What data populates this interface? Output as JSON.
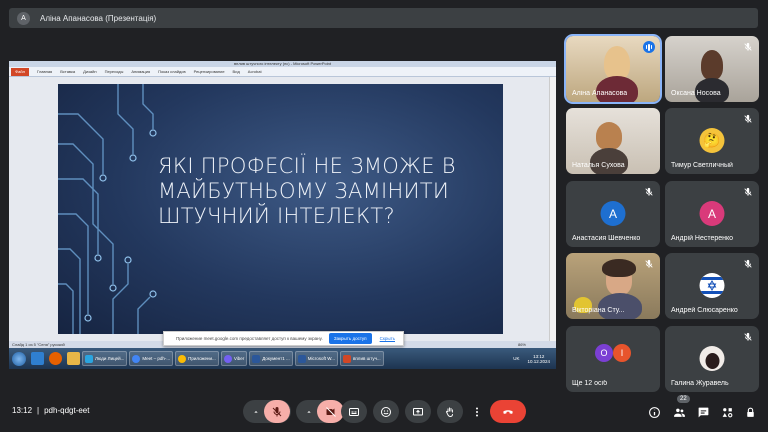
{
  "presenter": {
    "avatar_letter": "A",
    "title": "Аліна Апанасова (Презентація)"
  },
  "powerpoint": {
    "window_title": "вплив штучного інтелекту (пс) - Microsoft PowerPoint",
    "file_tab": "Файл",
    "tabs": [
      "Главная",
      "Вставка",
      "Дизайн",
      "Переходы",
      "Анимация",
      "Показ слайдов",
      "Рецензирование",
      "Вид",
      "Acrobat"
    ],
    "slide_text": "ЯКІ ПРОФЕСІЇ НЕ ЗМОЖЕ В МАЙБУТНЬОМУ ЗАМІНИТИ ШТУЧНИЙ ІНТЕЛЕКТ?",
    "status": "Слайд 1 из 5   \"Сеня\"   русский",
    "zoom": "86%"
  },
  "share_notice": {
    "text": "Приложение meet.google.com предоставляет доступ к вашему экрану.",
    "stop_label": "Закрыть доступ",
    "hide_label": "Скрыть"
  },
  "taskbar": {
    "tasks": [
      {
        "label": "Люди Лицей...",
        "color": "#2aa5e0"
      },
      {
        "label": "Meet – pdh-...",
        "color": "#4285f4"
      },
      {
        "label": "Приложени...",
        "color": "#fbbc05"
      },
      {
        "label": "Viber",
        "color": "#7360f2"
      },
      {
        "label": "Документ1 ...",
        "color": "#2b579a"
      },
      {
        "label": "Microsoft W...",
        "color": "#2b579a"
      },
      {
        "label": "вплив штуч...",
        "color": "#d24726"
      }
    ],
    "lang": "UK",
    "time": "13:12",
    "date": "10.12.2024"
  },
  "participants": [
    {
      "name": "Аліна Апанасова",
      "kind": "video",
      "speaking": true
    },
    {
      "name": "Оксана Носова",
      "kind": "video",
      "muted": true
    },
    {
      "name": "Наталья Сухова",
      "kind": "video"
    },
    {
      "name": "Тимур Светличный",
      "kind": "emoji",
      "muted": true
    },
    {
      "name": "Анастасия Шевченко",
      "kind": "avatar",
      "letter": "A",
      "color": "#1e6fd0",
      "muted": true
    },
    {
      "name": "Андрій Нестеренко",
      "kind": "avatar",
      "letter": "A",
      "color": "#d93a7a",
      "muted": true
    },
    {
      "name": "Вікторіана Сту...",
      "kind": "video",
      "muted": true
    },
    {
      "name": "Андрей Слюсаренко",
      "kind": "flag",
      "muted": true
    },
    {
      "name": "Ще 12 осіб",
      "kind": "more",
      "letters": [
        "O",
        "I"
      ],
      "colors": [
        "#7b3fd4",
        "#e8542c"
      ]
    },
    {
      "name": "Галина Журавель",
      "kind": "photo",
      "muted": true
    }
  ],
  "meeting": {
    "time": "13:12",
    "separator": "|",
    "code": "pdh-qdgt-eet",
    "participant_count": "22"
  },
  "icons": {
    "mic": "mic-off-icon",
    "camera": "camera-off-icon",
    "captions": "captions-icon",
    "emoji": "emoji-icon",
    "present": "present-icon",
    "hand": "raise-hand-icon",
    "more": "more-icon",
    "hangup": "hangup-icon",
    "info": "info-icon",
    "people": "people-icon",
    "chat": "chat-icon",
    "activities": "activities-icon",
    "lock": "host-controls-icon"
  }
}
